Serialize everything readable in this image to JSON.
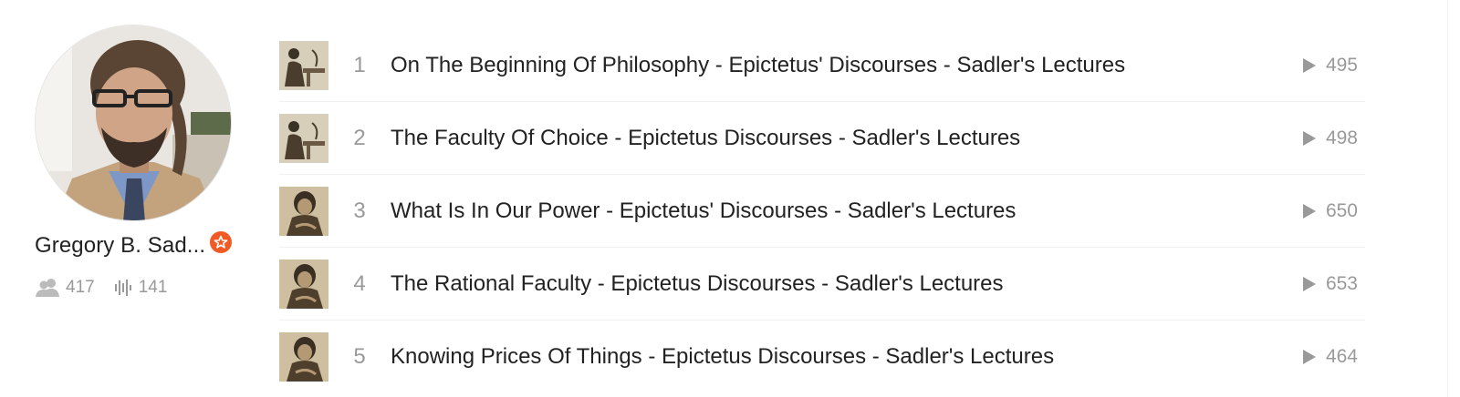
{
  "artist": {
    "name": "Gregory B. Sad...",
    "followers": "417",
    "tracks": "141"
  },
  "tracks": [
    {
      "number": "1",
      "title": "On The Beginning Of Philosophy - Epictetus' Discourses - Sadler's Lectures",
      "plays": "495"
    },
    {
      "number": "2",
      "title": "The Faculty Of Choice - Epictetus Discourses - Sadler's Lectures",
      "plays": "498"
    },
    {
      "number": "3",
      "title": "What Is In Our Power - Epictetus' Discourses - Sadler's Lectures",
      "plays": "650"
    },
    {
      "number": "4",
      "title": "The Rational Faculty - Epictetus Discourses - Sadler's Lectures",
      "plays": "653"
    },
    {
      "number": "5",
      "title": "Knowing Prices Of Things - Epictetus Discourses - Sadler's Lectures",
      "plays": "464"
    }
  ],
  "colors": {
    "accent": "#f15a24",
    "muted": "#999999",
    "text": "#222222"
  },
  "icons": {
    "badge": "pro-star-icon",
    "followers": "followers-icon",
    "tracks": "waveform-icon",
    "play": "play-icon"
  }
}
